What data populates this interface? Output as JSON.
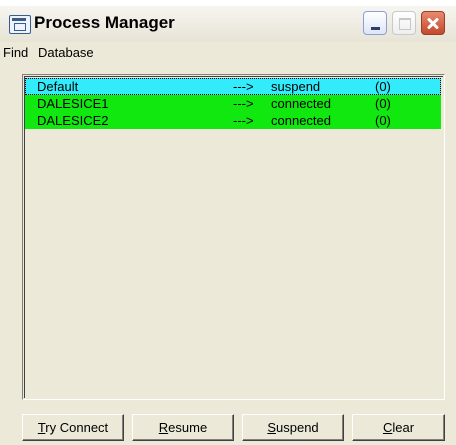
{
  "window": {
    "title": "Process Manager"
  },
  "menu": {
    "items": [
      {
        "label": "Find"
      },
      {
        "label": "Database"
      }
    ]
  },
  "list": {
    "rows": [
      {
        "name": "Default",
        "arrow": "--->",
        "status": "suspend",
        "count": "(0)",
        "color": "#33ecfb",
        "selected": true
      },
      {
        "name": "DALESICE1",
        "arrow": "--->",
        "status": "connected",
        "count": "(0)",
        "color": "#10e810",
        "selected": false
      },
      {
        "name": "DALESICE2",
        "arrow": "--->",
        "status": "connected",
        "count": "(0)",
        "color": "#10e810",
        "selected": false
      }
    ]
  },
  "buttons": {
    "try_connect": {
      "accel": "T",
      "rest": "ry Connect"
    },
    "resume": {
      "accel": "R",
      "rest": "esume"
    },
    "suspend": {
      "accel": "S",
      "rest": "uspend"
    },
    "clear": {
      "accel": "C",
      "rest": "lear"
    }
  },
  "icons": {
    "app": "process-window-icon",
    "minimize": "minimize-icon",
    "maximize": "maximize-icon",
    "close": "close-icon"
  }
}
